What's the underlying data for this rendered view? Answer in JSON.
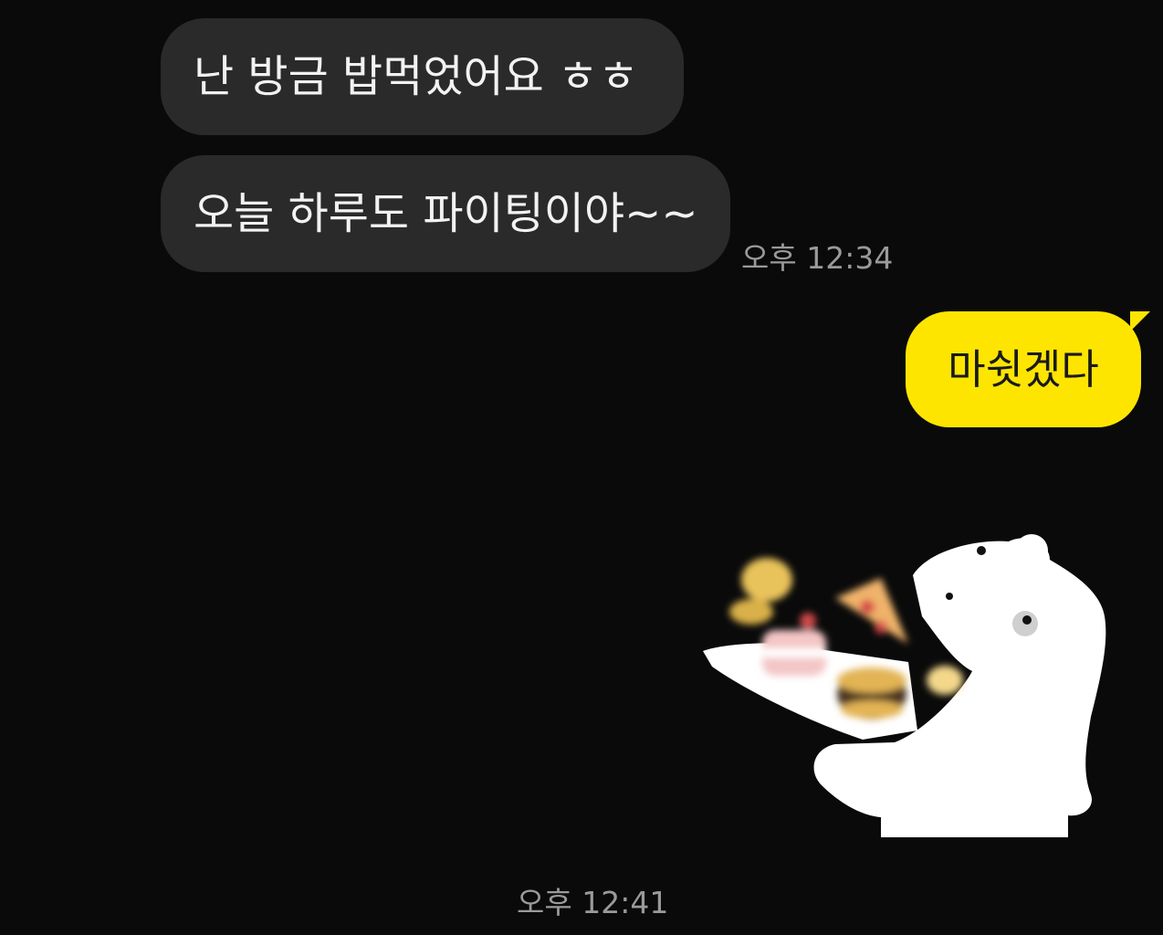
{
  "messages": [
    {
      "text": "난 방금 밥먹었어요 ㅎㅎ"
    },
    {
      "text": "오늘 하루도 파이팅이야~~"
    }
  ],
  "received_time": "오후 12:34",
  "sent_message": {
    "text": "마쉿겠다"
  },
  "sticker": {
    "icon": "bear-eating-food-sticker"
  },
  "sent_time": "오후 12:41",
  "colors": {
    "background": "#0a0a0a",
    "incoming_bubble": "#2a2a2a",
    "outgoing_bubble": "#fee500",
    "timestamp": "#9a9a9a"
  }
}
